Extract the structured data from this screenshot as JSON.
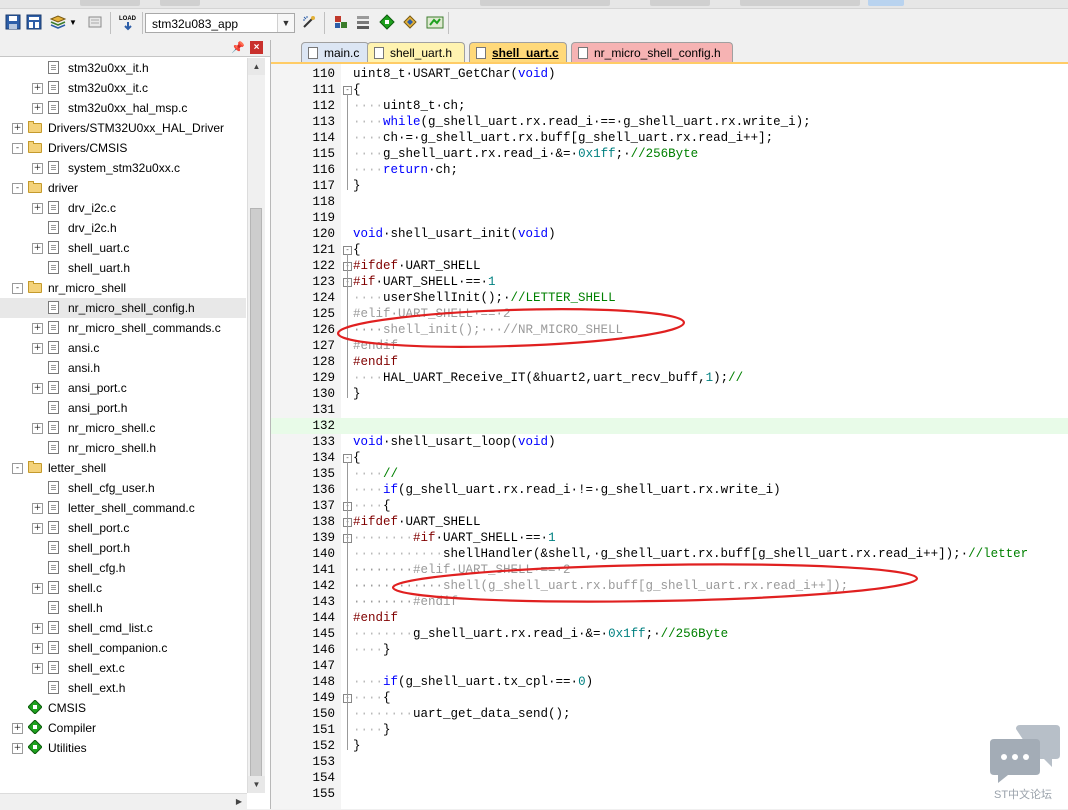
{
  "toolbar": {
    "target_name": "stm32u083_app",
    "icons": [
      "save-icon",
      "save-all-icon",
      "stack-icon",
      "dropdown-arrow-icon",
      "device-icon",
      "load-icon",
      "target-options-icon",
      "magic-wand-icon",
      "manage-components-icon",
      "books-icon",
      "green-diamond-icon",
      "pack-installer-icon"
    ]
  },
  "panel": {
    "pin": " ‡",
    "close": "×"
  },
  "tree": [
    {
      "level": 2,
      "type": "file",
      "expander": "",
      "label": "stm32u0xx_it.h"
    },
    {
      "level": 2,
      "type": "file",
      "expander": "+",
      "label": "stm32u0xx_it.c"
    },
    {
      "level": 2,
      "type": "file",
      "expander": "+",
      "label": "stm32u0xx_hal_msp.c"
    },
    {
      "level": 1,
      "type": "folder",
      "expander": "+",
      "label": "Drivers/STM32U0xx_HAL_Driver"
    },
    {
      "level": 1,
      "type": "folder",
      "expander": "-",
      "label": "Drivers/CMSIS"
    },
    {
      "level": 2,
      "type": "file",
      "expander": "+",
      "label": "system_stm32u0xx.c"
    },
    {
      "level": 1,
      "type": "folder",
      "expander": "-",
      "label": "driver"
    },
    {
      "level": 2,
      "type": "file",
      "expander": "+",
      "label": "drv_i2c.c"
    },
    {
      "level": 2,
      "type": "file",
      "expander": "",
      "label": "drv_i2c.h"
    },
    {
      "level": 2,
      "type": "file",
      "expander": "+",
      "label": "shell_uart.c"
    },
    {
      "level": 2,
      "type": "file",
      "expander": "",
      "label": "shell_uart.h"
    },
    {
      "level": 1,
      "type": "folder",
      "expander": "-",
      "label": "nr_micro_shell"
    },
    {
      "level": 2,
      "type": "file",
      "expander": "",
      "label": "nr_micro_shell_config.h",
      "selected": true
    },
    {
      "level": 2,
      "type": "file",
      "expander": "+",
      "label": "nr_micro_shell_commands.c"
    },
    {
      "level": 2,
      "type": "file",
      "expander": "+",
      "label": "ansi.c"
    },
    {
      "level": 2,
      "type": "file",
      "expander": "",
      "label": "ansi.h"
    },
    {
      "level": 2,
      "type": "file",
      "expander": "+",
      "label": "ansi_port.c"
    },
    {
      "level": 2,
      "type": "file",
      "expander": "",
      "label": "ansi_port.h"
    },
    {
      "level": 2,
      "type": "file",
      "expander": "+",
      "label": "nr_micro_shell.c"
    },
    {
      "level": 2,
      "type": "file",
      "expander": "",
      "label": "nr_micro_shell.h"
    },
    {
      "level": 1,
      "type": "folder",
      "expander": "-",
      "label": "letter_shell"
    },
    {
      "level": 2,
      "type": "file",
      "expander": "",
      "label": "shell_cfg_user.h"
    },
    {
      "level": 2,
      "type": "file",
      "expander": "+",
      "label": "letter_shell_command.c"
    },
    {
      "level": 2,
      "type": "file",
      "expander": "+",
      "label": "shell_port.c"
    },
    {
      "level": 2,
      "type": "file",
      "expander": "",
      "label": "shell_port.h"
    },
    {
      "level": 2,
      "type": "file",
      "expander": "",
      "label": "shell_cfg.h"
    },
    {
      "level": 2,
      "type": "file",
      "expander": "+",
      "label": "shell.c"
    },
    {
      "level": 2,
      "type": "file",
      "expander": "",
      "label": "shell.h"
    },
    {
      "level": 2,
      "type": "file",
      "expander": "+",
      "label": "shell_cmd_list.c"
    },
    {
      "level": 2,
      "type": "file",
      "expander": "+",
      "label": "shell_companion.c"
    },
    {
      "level": 2,
      "type": "file",
      "expander": "+",
      "label": "shell_ext.c"
    },
    {
      "level": 2,
      "type": "file",
      "expander": "",
      "label": "shell_ext.h"
    },
    {
      "level": 1,
      "type": "component",
      "expander": "",
      "label": "CMSIS"
    },
    {
      "level": 1,
      "type": "component",
      "expander": "+",
      "label": "Compiler"
    },
    {
      "level": 1,
      "type": "component",
      "expander": "+",
      "label": "Utilities"
    }
  ],
  "tabs": [
    {
      "label": "main.c",
      "color": "#dce6f4",
      "active": false
    },
    {
      "label": "shell_uart.h",
      "color": "#fff3b0",
      "active": false
    },
    {
      "label": "shell_uart.c",
      "color": "#ffd97a",
      "active": true
    },
    {
      "label": "nr_micro_shell_config.h",
      "color": "#f6b3b3",
      "active": false
    }
  ],
  "colors": {
    "keyword": "#0000ff",
    "comment": "#008000",
    "number": "#008080",
    "preprocessor": "#800000",
    "annotation": "#e02020",
    "current_line": "#e8fbe8"
  },
  "code_lines": [
    {
      "n": "110",
      "fold": "",
      "tokens": [
        [
          "t",
          "uint8_t·USART_GetChar("
        ],
        [
          "k",
          "void"
        ],
        [
          "t",
          ")"
        ]
      ]
    },
    {
      "n": "111",
      "fold": "-",
      "tokens": [
        [
          "t",
          "{"
        ]
      ]
    },
    {
      "n": "112",
      "fold": "",
      "tokens": [
        [
          "d",
          "····"
        ],
        [
          "t",
          "uint8_t·ch;"
        ]
      ]
    },
    {
      "n": "113",
      "fold": "",
      "tokens": [
        [
          "d",
          "····"
        ],
        [
          "k",
          "while"
        ],
        [
          "t",
          "(g_shell_uart.rx.read_i·==·g_shell_uart.rx.write_i);"
        ]
      ]
    },
    {
      "n": "114",
      "fold": "",
      "tokens": [
        [
          "d",
          "····"
        ],
        [
          "t",
          "ch·=·g_shell_uart.rx.buff[g_shell_uart.rx.read_i++];"
        ]
      ]
    },
    {
      "n": "115",
      "fold": "",
      "tokens": [
        [
          "d",
          "····"
        ],
        [
          "t",
          "g_shell_uart.rx.read_i·&=·"
        ],
        [
          "n",
          "0x1ff"
        ],
        [
          "t",
          ";·"
        ],
        [
          "c",
          "//256Byte"
        ]
      ]
    },
    {
      "n": "116",
      "fold": "",
      "tokens": [
        [
          "d",
          "····"
        ],
        [
          "k",
          "return"
        ],
        [
          "t",
          "·ch;"
        ]
      ]
    },
    {
      "n": "117",
      "fold": "",
      "tokens": [
        [
          "t",
          "}"
        ]
      ]
    },
    {
      "n": "118",
      "fold": "",
      "tokens": []
    },
    {
      "n": "119",
      "fold": "",
      "tokens": []
    },
    {
      "n": "120",
      "fold": "",
      "tokens": [
        [
          "k",
          "void"
        ],
        [
          "t",
          "·shell_usart_init("
        ],
        [
          "k",
          "void"
        ],
        [
          "t",
          ")"
        ]
      ]
    },
    {
      "n": "121",
      "fold": "-",
      "tokens": [
        [
          "t",
          "{"
        ]
      ]
    },
    {
      "n": "122",
      "fold": "-",
      "tokens": [
        [
          "p",
          "#ifdef"
        ],
        [
          "t",
          "·UART_SHELL"
        ]
      ]
    },
    {
      "n": "123",
      "fold": "-",
      "tokens": [
        [
          "p",
          "#if"
        ],
        [
          "t",
          "·UART_SHELL·==·"
        ],
        [
          "n",
          "1"
        ]
      ]
    },
    {
      "n": "124",
      "fold": "",
      "tokens": [
        [
          "d",
          "····"
        ],
        [
          "t",
          "userShellInit();·"
        ],
        [
          "c",
          "//LETTER_SHELL"
        ]
      ]
    },
    {
      "n": "125",
      "fold": "",
      "tokens": [
        [
          "x",
          "#elif·UART_SHELL·==·2"
        ]
      ]
    },
    {
      "n": "126",
      "fold": "",
      "tokens": [
        [
          "x",
          "····shell_init();···//NR_MICRO_SHELL"
        ]
      ]
    },
    {
      "n": "127",
      "fold": "",
      "tokens": [
        [
          "x",
          "#endif"
        ]
      ]
    },
    {
      "n": "128",
      "fold": "",
      "tokens": [
        [
          "p",
          "#endif"
        ]
      ]
    },
    {
      "n": "129",
      "fold": "",
      "tokens": [
        [
          "d",
          "····"
        ],
        [
          "t",
          "HAL_UART_Receive_IT(&huart2,uart_recv_buff,"
        ],
        [
          "n",
          "1"
        ],
        [
          "t",
          ");"
        ],
        [
          "c",
          "//"
        ]
      ]
    },
    {
      "n": "130",
      "fold": "",
      "tokens": [
        [
          "t",
          "}"
        ]
      ]
    },
    {
      "n": "131",
      "fold": "",
      "tokens": []
    },
    {
      "n": "132",
      "fold": "",
      "tokens": [],
      "current": true
    },
    {
      "n": "133",
      "fold": "",
      "tokens": [
        [
          "k",
          "void"
        ],
        [
          "t",
          "·shell_usart_loop("
        ],
        [
          "k",
          "void"
        ],
        [
          "t",
          ")"
        ]
      ]
    },
    {
      "n": "134",
      "fold": "-",
      "tokens": [
        [
          "t",
          "{"
        ]
      ]
    },
    {
      "n": "135",
      "fold": "",
      "tokens": [
        [
          "d",
          "····"
        ],
        [
          "c",
          "//"
        ]
      ]
    },
    {
      "n": "136",
      "fold": "",
      "tokens": [
        [
          "d",
          "····"
        ],
        [
          "k",
          "if"
        ],
        [
          "t",
          "(g_shell_uart.rx.read_i·!=·g_shell_uart.rx.write_i)"
        ]
      ]
    },
    {
      "n": "137",
      "fold": "-",
      "tokens": [
        [
          "d",
          "····"
        ],
        [
          "t",
          "{"
        ]
      ]
    },
    {
      "n": "138",
      "fold": "-",
      "tokens": [
        [
          "p",
          "#ifdef"
        ],
        [
          "t",
          "·UART_SHELL"
        ]
      ]
    },
    {
      "n": "139",
      "fold": "-",
      "tokens": [
        [
          "d",
          "········"
        ],
        [
          "p",
          "#if"
        ],
        [
          "t",
          "·UART_SHELL·==·"
        ],
        [
          "n",
          "1"
        ]
      ]
    },
    {
      "n": "140",
      "fold": "",
      "tokens": [
        [
          "d",
          "············"
        ],
        [
          "t",
          "shellHandler(&shell,·g_shell_uart.rx.buff[g_shell_uart.rx.read_i++]);·"
        ],
        [
          "c",
          "//letter"
        ]
      ]
    },
    {
      "n": "141",
      "fold": "",
      "tokens": [
        [
          "x",
          "········#elif·UART_SHELL·==·2"
        ]
      ]
    },
    {
      "n": "142",
      "fold": "",
      "tokens": [
        [
          "x",
          "············shell(g_shell_uart.rx.buff[g_shell_uart.rx.read_i++]);"
        ]
      ]
    },
    {
      "n": "143",
      "fold": "",
      "tokens": [
        [
          "x",
          "········#endif"
        ]
      ]
    },
    {
      "n": "144",
      "fold": "",
      "tokens": [
        [
          "p",
          "#endif"
        ]
      ]
    },
    {
      "n": "145",
      "fold": "",
      "tokens": [
        [
          "d",
          "········"
        ],
        [
          "t",
          "g_shell_uart.rx.read_i·&=·"
        ],
        [
          "n",
          "0x1ff"
        ],
        [
          "t",
          ";·"
        ],
        [
          "c",
          "//256Byte"
        ]
      ]
    },
    {
      "n": "146",
      "fold": "",
      "tokens": [
        [
          "d",
          "····"
        ],
        [
          "t",
          "}"
        ]
      ]
    },
    {
      "n": "147",
      "fold": "",
      "tokens": []
    },
    {
      "n": "148",
      "fold": "",
      "tokens": [
        [
          "d",
          "····"
        ],
        [
          "k",
          "if"
        ],
        [
          "t",
          "(g_shell_uart.tx_cpl·==·"
        ],
        [
          "n",
          "0"
        ],
        [
          "t",
          ")"
        ]
      ]
    },
    {
      "n": "149",
      "fold": "-",
      "tokens": [
        [
          "d",
          "····"
        ],
        [
          "t",
          "{"
        ]
      ]
    },
    {
      "n": "150",
      "fold": "",
      "tokens": [
        [
          "d",
          "········"
        ],
        [
          "t",
          "uart_get_data_send();"
        ]
      ]
    },
    {
      "n": "151",
      "fold": "",
      "tokens": [
        [
          "d",
          "····"
        ],
        [
          "t",
          "}"
        ]
      ]
    },
    {
      "n": "152",
      "fold": "",
      "tokens": [
        [
          "t",
          "}"
        ]
      ]
    },
    {
      "n": "153",
      "fold": "",
      "tokens": []
    },
    {
      "n": "154",
      "fold": "",
      "tokens": []
    },
    {
      "n": "155",
      "fold": "",
      "tokens": []
    }
  ],
  "watermark": {
    "text": "ST中文论坛"
  }
}
